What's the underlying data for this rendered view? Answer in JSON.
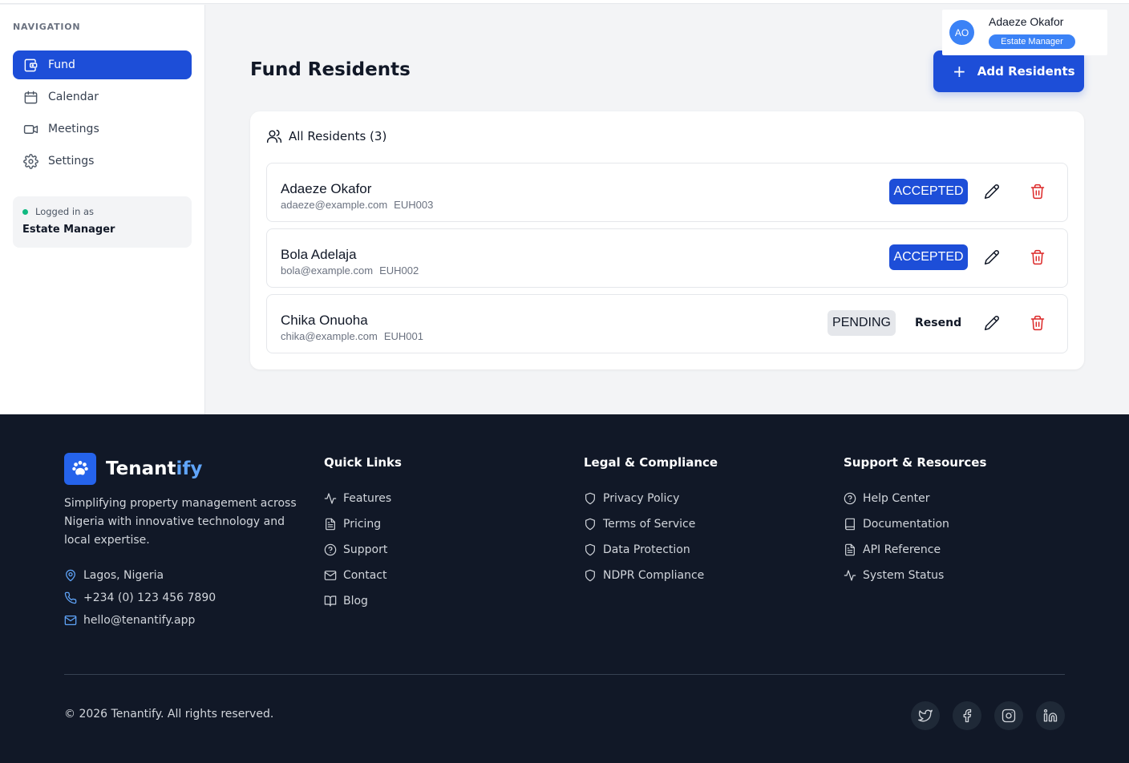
{
  "sidebar": {
    "heading": "NAVIGATION",
    "items": [
      {
        "label": "Fund",
        "icon": "wallet-icon",
        "active": true
      },
      {
        "label": "Calendar",
        "icon": "calendar-icon",
        "active": false
      },
      {
        "label": "Meetings",
        "icon": "video-icon",
        "active": false
      },
      {
        "label": "Settings",
        "icon": "gear-icon",
        "active": false
      }
    ],
    "login": {
      "label": "Logged in as",
      "role": "Estate Manager"
    }
  },
  "header": {
    "user": {
      "initials": "AO",
      "name": "Adaeze Okafor",
      "role": "Estate Manager"
    }
  },
  "main": {
    "title": "Fund Residents",
    "add_button": "Add Residents",
    "list_title": "All Residents (3)",
    "residents": [
      {
        "name": "Adaeze Okafor",
        "email": "adaeze@example.com",
        "unit": "EUH003",
        "status": "ACCEPTED"
      },
      {
        "name": "Bola Adelaja",
        "email": "bola@example.com",
        "unit": "EUH002",
        "status": "ACCEPTED"
      },
      {
        "name": "Chika Onuoha",
        "email": "chika@example.com",
        "unit": "EUH001",
        "status": "PENDING",
        "action": "Resend"
      }
    ]
  },
  "footer": {
    "brand": {
      "name_main": "Tenant",
      "name_accent": "ify"
    },
    "tagline": "Simplifying property management across Nigeria with innovative technology and local expertise.",
    "contact": {
      "location": "Lagos, Nigeria",
      "phone": "+234 (0) 123 456 7890",
      "email": "hello@tenantify.app"
    },
    "quick_links": {
      "title": "Quick Links",
      "items": [
        "Features",
        "Pricing",
        "Support",
        "Contact",
        "Blog"
      ]
    },
    "legal": {
      "title": "Legal & Compliance",
      "items": [
        "Privacy Policy",
        "Terms of Service",
        "Data Protection",
        "NDPR Compliance"
      ]
    },
    "support": {
      "title": "Support & Resources",
      "items": [
        "Help Center",
        "Documentation",
        "API Reference",
        "System Status"
      ]
    },
    "copyright": "© 2026 Tenantify. All rights reserved.",
    "social": [
      "twitter-icon",
      "facebook-icon",
      "instagram-icon",
      "linkedin-icon"
    ]
  },
  "colors": {
    "primary": "#1d4ed8",
    "accent": "#3b82f6",
    "footer_bg": "#111827",
    "danger": "#dc2626",
    "online": "#10b981"
  }
}
